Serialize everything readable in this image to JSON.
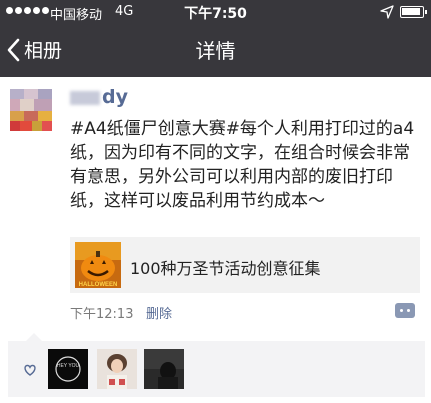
{
  "status_bar": {
    "carrier": "中国移动",
    "network": "4G",
    "time": "下午7:50",
    "battery_level": 0.95
  },
  "nav": {
    "back_label": "相册",
    "title": "详情"
  },
  "post": {
    "author": "dy",
    "text": "#A4纸僵尸创意大赛#每个人利用打印过的a4纸，因为印有不同的文字，在组合时候会非常有意思，另外公司可以利用内部的废旧打印纸，这样可以废品利用节约成本～",
    "link_card": {
      "title": "100种万圣节活动创意征集",
      "thumb_text": "HALLOWEEN"
    },
    "time": "下午12:13",
    "delete_label": "删除"
  },
  "likes": {
    "avatars": [
      "liker-1",
      "liker-2",
      "liker-3"
    ],
    "avatar_1_text": "HEY YOU"
  },
  "colors": {
    "nav_bg": "#38373c",
    "link_blue": "#576b95",
    "likes_bg": "#f3f3f5"
  }
}
